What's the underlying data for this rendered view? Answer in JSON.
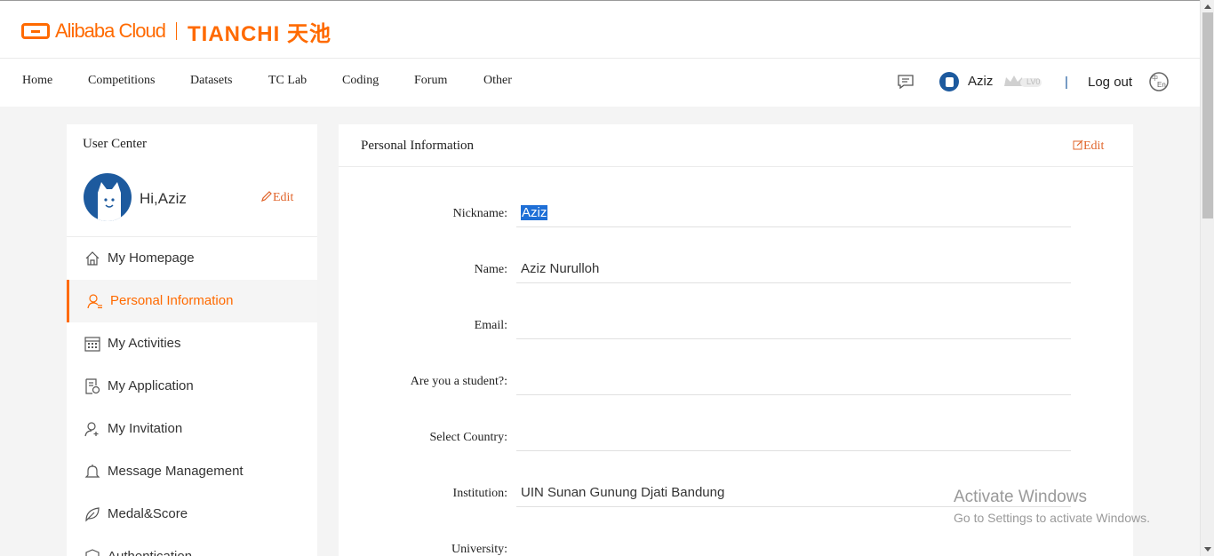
{
  "brand": {
    "alibaba": "Alibaba Cloud",
    "tianchi": "TIANCHI 天池"
  },
  "nav": {
    "items": [
      "Home",
      "Competitions",
      "Datasets",
      "TC Lab",
      "Coding",
      "Forum",
      "Other"
    ],
    "username": "Aziz",
    "level": "LV0",
    "separator": "|",
    "logout": "Log out"
  },
  "sidebar": {
    "title": "User Center",
    "greeting": "Hi,Aziz",
    "edit": "Edit",
    "items": [
      {
        "label": "My Homepage",
        "icon": "home-icon"
      },
      {
        "label": "Personal Information",
        "icon": "user-info-icon",
        "active": true
      },
      {
        "label": "My Activities",
        "icon": "calendar-icon"
      },
      {
        "label": "My Application",
        "icon": "application-icon"
      },
      {
        "label": "My Invitation",
        "icon": "add-user-icon"
      },
      {
        "label": "Message Management",
        "icon": "bell-icon"
      },
      {
        "label": "Medal&Score",
        "icon": "leaf-icon"
      },
      {
        "label": "Authentication",
        "icon": "shield-icon"
      }
    ]
  },
  "main": {
    "title": "Personal Information",
    "edit": "Edit",
    "fields": [
      {
        "label": "Nickname:",
        "value": "Aziz",
        "selected": true
      },
      {
        "label": "Name:",
        "value": "Aziz Nurulloh"
      },
      {
        "label": "Email:",
        "value": ""
      },
      {
        "label": "Are you a student?:",
        "value": ""
      },
      {
        "label": "Select Country:",
        "value": ""
      },
      {
        "label": "Institution:",
        "value": "UIN Sunan Gunung Djati Bandung"
      },
      {
        "label": "University:",
        "value": ""
      }
    ]
  },
  "watermark": {
    "line1": "Activate Windows",
    "line2": "Go to Settings to activate Windows."
  },
  "colors": {
    "accent": "#ff6a00",
    "edit": "#e0642a",
    "avatar": "#1d5a9e",
    "selection": "#1e6fd6"
  }
}
